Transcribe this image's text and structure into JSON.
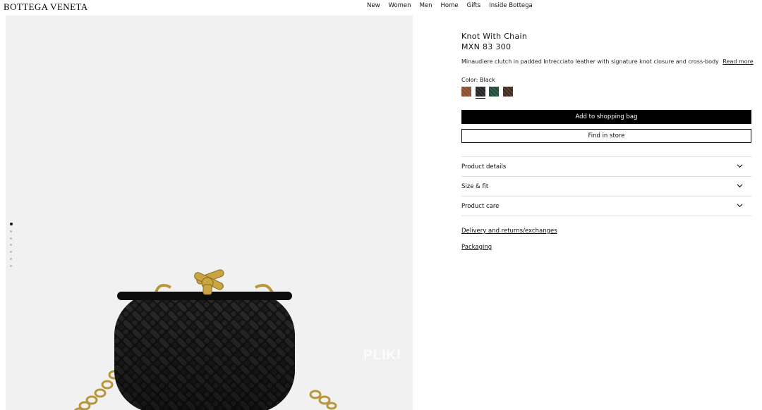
{
  "header": {
    "logo": "BOTTEGA VENETA",
    "nav": [
      "New",
      "Women",
      "Men",
      "Home",
      "Gifts",
      "Inside Bottega"
    ]
  },
  "gallery": {
    "dot_count": 7,
    "active_index": 0,
    "watermark": "PLIKI"
  },
  "product": {
    "title": "Knot With Chain",
    "price": "MXN 83 300",
    "description": "Minaudiere clutch in padded Intrecciato leather with signature knot closure and cross-body",
    "read_more": "Read more",
    "color_label": "Color:",
    "color_value": "Black",
    "swatches": [
      {
        "color": "#8a4a2a",
        "selected": false
      },
      {
        "color": "#222222",
        "selected": true
      },
      {
        "color": "#1f4a35",
        "selected": false
      },
      {
        "color": "#3d2a1e",
        "selected": false
      }
    ],
    "add_to_bag": "Add to shopping bag",
    "find_in_store": "Find in store"
  },
  "accordion": [
    {
      "label": "Product details"
    },
    {
      "label": "Size & fit"
    },
    {
      "label": "Product care"
    }
  ],
  "links": {
    "delivery": "Delivery and returns/exchanges",
    "packaging": "Packaging"
  }
}
